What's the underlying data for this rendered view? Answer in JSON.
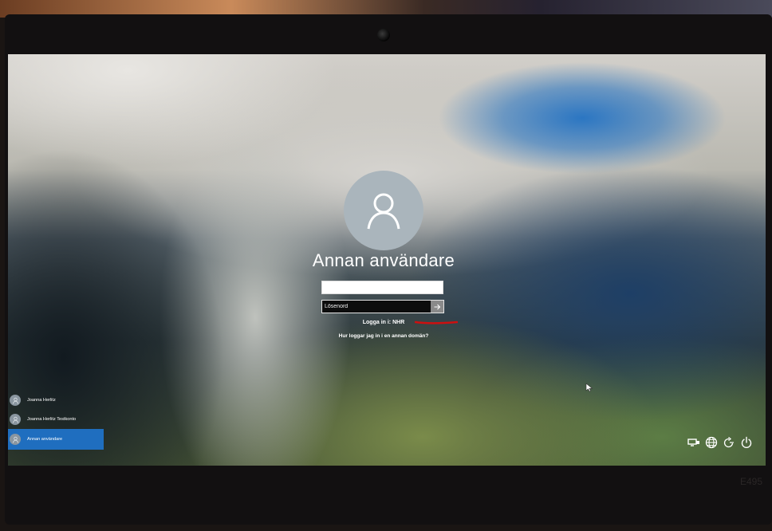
{
  "login": {
    "user_title": "Annan användare",
    "username_value": "",
    "password_placeholder": "Lösenord",
    "sign_in_domain": "Logga in i: NHR",
    "other_domain_link": "Hur loggar jag in i en annan domän?"
  },
  "users": [
    {
      "name": "Joanna Herlitz",
      "selected": false
    },
    {
      "name": "Joanna Herlitz Testkonto",
      "selected": false
    },
    {
      "name": "Annan användare",
      "selected": true
    }
  ],
  "system_icons": [
    "network-icon",
    "globe-icon",
    "accessibility-icon",
    "power-icon"
  ],
  "laptop": {
    "model_label": "E495"
  },
  "colors": {
    "selected_user": "#1f6ebf",
    "annotation_mark": "#cc1010",
    "avatar": "#aab5bc"
  }
}
